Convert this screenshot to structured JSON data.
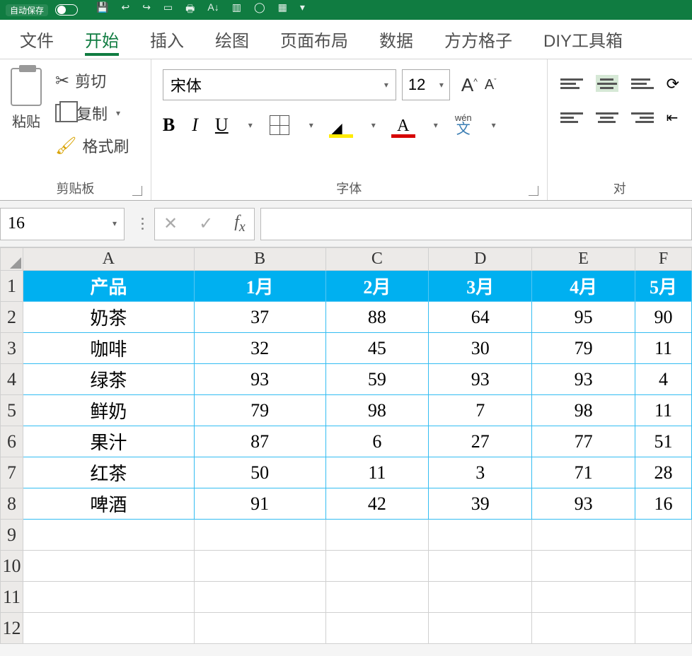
{
  "titlebar": {
    "autosave": "自动保存"
  },
  "tabs": {
    "file": "文件",
    "home": "开始",
    "insert": "插入",
    "draw": "绘图",
    "layout": "页面布局",
    "data": "数据",
    "fangfang": "方方格子",
    "diy": "DIY工具箱"
  },
  "clipboard": {
    "paste": "粘贴",
    "cut": "剪切",
    "copy": "复制",
    "format_painter": "格式刷",
    "group": "剪贴板"
  },
  "font": {
    "name": "宋体",
    "size": "12",
    "bold": "B",
    "italic": "I",
    "underline": "U",
    "color_letter": "A",
    "phonetic_top": "wén",
    "phonetic_bottom": "文",
    "group": "字体"
  },
  "align": {
    "group": "对"
  },
  "namebox": {
    "ref": "16"
  },
  "sheet": {
    "columns": [
      "A",
      "B",
      "C",
      "D",
      "E",
      "F"
    ],
    "row_nums": [
      "1",
      "2",
      "3",
      "4",
      "5",
      "6",
      "7",
      "8",
      "9",
      "10",
      "11",
      "12"
    ],
    "header": [
      "产品",
      "1月",
      "2月",
      "3月",
      "4月",
      "5月"
    ],
    "rows": [
      [
        "奶茶",
        "37",
        "88",
        "64",
        "95",
        "90"
      ],
      [
        "咖啡",
        "32",
        "45",
        "30",
        "79",
        "11"
      ],
      [
        "绿茶",
        "93",
        "59",
        "93",
        "93",
        "4"
      ],
      [
        "鲜奶",
        "79",
        "98",
        "7",
        "98",
        "11"
      ],
      [
        "果汁",
        "87",
        "6",
        "27",
        "77",
        "51"
      ],
      [
        "红茶",
        "50",
        "11",
        "3",
        "71",
        "28"
      ],
      [
        "啤酒",
        "91",
        "42",
        "39",
        "93",
        "16"
      ]
    ]
  },
  "chart_data": {
    "type": "table",
    "title": "",
    "columns": [
      "产品",
      "1月",
      "2月",
      "3月",
      "4月",
      "5月"
    ],
    "rows": [
      {
        "产品": "奶茶",
        "1月": 37,
        "2月": 88,
        "3月": 64,
        "4月": 95,
        "5月": 90
      },
      {
        "产品": "咖啡",
        "1月": 32,
        "2月": 45,
        "3月": 30,
        "4月": 79,
        "5月": 11
      },
      {
        "产品": "绿茶",
        "1月": 93,
        "2月": 59,
        "3月": 93,
        "4月": 93,
        "5月": 4
      },
      {
        "产品": "鲜奶",
        "1月": 79,
        "2月": 98,
        "3月": 7,
        "4月": 98,
        "5月": 11
      },
      {
        "产品": "果汁",
        "1月": 87,
        "2月": 6,
        "3月": 27,
        "4月": 77,
        "5月": 51
      },
      {
        "产品": "红茶",
        "1月": 50,
        "2月": 11,
        "3月": 3,
        "4月": 71,
        "5月": 28
      },
      {
        "产品": "啤酒",
        "1月": 91,
        "2月": 42,
        "3月": 39,
        "4月": 93,
        "5月": 16
      }
    ]
  }
}
